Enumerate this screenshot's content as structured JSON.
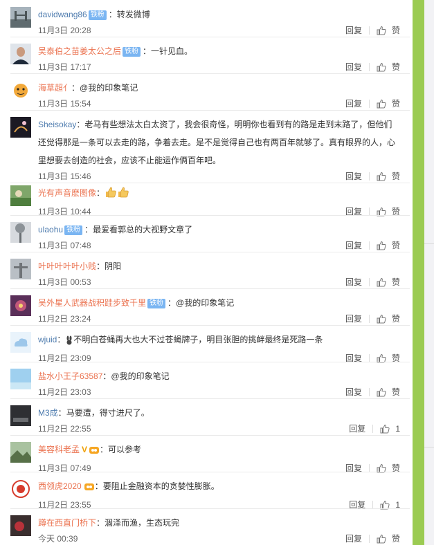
{
  "ui": {
    "reply_label": "回复",
    "like_label": "赞",
    "badge_label": "铁粉",
    "colon": "："
  },
  "comments": [
    {
      "user": "davidwang86",
      "badge": true,
      "text": "转发微博",
      "time": "11月3日 20:28",
      "likes": "",
      "avatar": "city"
    },
    {
      "user": "吴泰伯之苗姜太公之后",
      "badge": true,
      "text": "一针见血。",
      "time": "11月3日 17:17",
      "likes": "",
      "avatar": "person"
    },
    {
      "user": "海草超亻",
      "badge": false,
      "text": "@我的印象笔记",
      "time": "11月3日 15:54",
      "likes": "",
      "avatar": "tiger"
    },
    {
      "user": "Sheisokay",
      "badge": false,
      "text": "老马有些想法太白太资了，我会很奇怪，明明你也看到有的路是走到末路了，但他们",
      "text2": "还觉得那是一条可以去走的路，争着去走。是不是觉得自己也有两百年就够了。真有眼界的人，心",
      "text3": "里想要去创造的社会，应该不止能运作俩百年吧。",
      "time": "11月3日 15:46",
      "likes": "",
      "avatar": "night"
    },
    {
      "user": "光有声音麽图像",
      "badge": false,
      "text": "",
      "time": "11月3日 10:44",
      "likes": "",
      "avatar": "garden",
      "emoji": "thumbs"
    },
    {
      "user": "ulaohu",
      "badge": true,
      "text": "最爱看郭总的大视野文章了",
      "time": "11月3日 07:48",
      "likes": "",
      "avatar": "tree"
    },
    {
      "user": "叶叶叶叶叶小贱",
      "badge": false,
      "text": "阴阳",
      "time": "11月3日 00:53",
      "likes": "",
      "avatar": "statue"
    },
    {
      "user": "吴外星人武器战积跬步致千里",
      "badge": true,
      "text": "@我的印象笔记",
      "time": "11月2日 23:24",
      "likes": "",
      "avatar": "flower"
    },
    {
      "user": "wjuid",
      "badge": false,
      "text": "不明白苍蝇再大也大不过苍蝇牌子，明目张胆的挑衅最终是死路一条",
      "time": "11月2日 23:09",
      "likes": "",
      "avatar": "cloud",
      "emoji": "bunny"
    },
    {
      "user": "盐水小王子63587",
      "badge": false,
      "text": "@我的印象笔记",
      "time": "11月2日 23:03",
      "likes": "",
      "avatar": "sky"
    },
    {
      "user": "M3成",
      "badge": false,
      "text": "马要遭，得寸进尺了。",
      "time": "11月2日 22:55",
      "likes": "1",
      "avatar": "dark"
    },
    {
      "user": "美容科老孟",
      "badge": false,
      "text": "可以参考",
      "time": "11月3日 07:49",
      "likes": "",
      "avatar": "landscape",
      "vip": "V"
    },
    {
      "user": "西领虎2020",
      "badge": false,
      "text": "要阻止金融资本的贪婪性膨胀。",
      "time": "11月2日 23:55",
      "likes": "1",
      "avatar": "seal"
    },
    {
      "user": "蹲在西直门桥下",
      "badge": false,
      "text": "涸泽而渔，生态玩完",
      "time": "今天 00:39",
      "likes": "",
      "avatar": "red"
    }
  ],
  "colors": {
    "accent_name": "#eb7350",
    "link": "#507daf",
    "badge": "#7ab5f2",
    "scroll_bar": "#9bcb52"
  }
}
